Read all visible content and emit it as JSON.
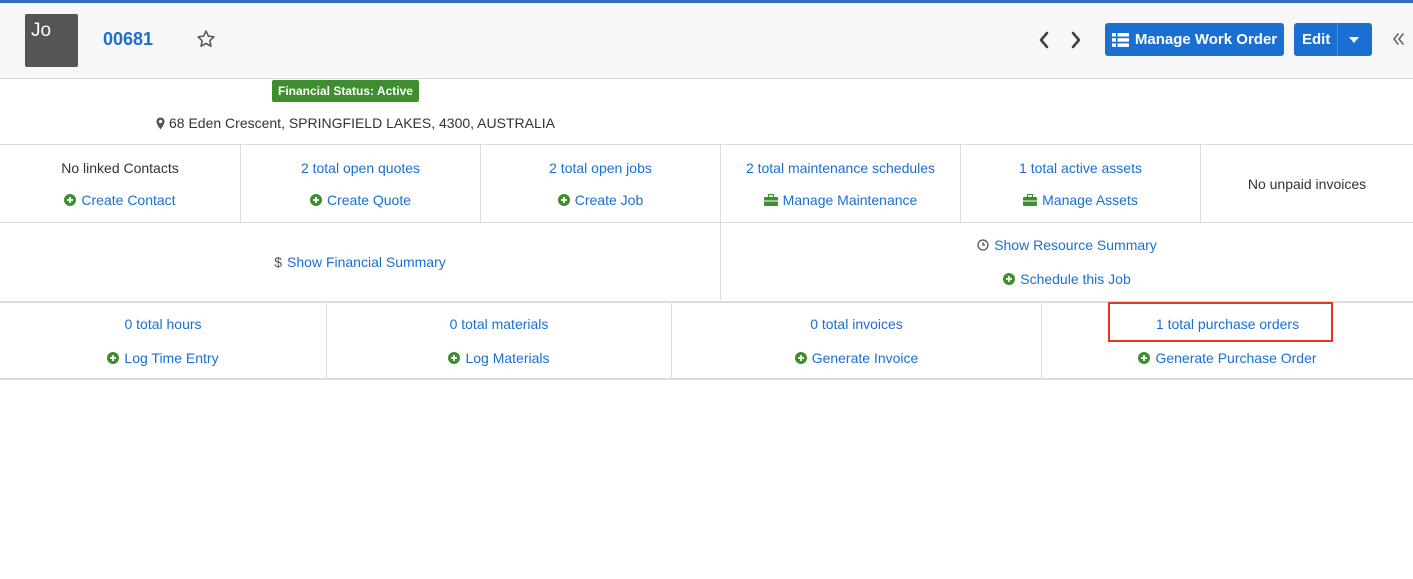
{
  "header": {
    "avatar_initials": "Jo",
    "work_order_number": "00681",
    "manage_button_label": "Manage Work Order",
    "edit_button_label": "Edit"
  },
  "summary": {
    "financial_status": "Financial Status: Active",
    "address": "68 Eden Crescent, SPRINGFIELD LAKES, 4300, AUSTRALIA"
  },
  "overview": {
    "contacts_text": "No linked Contacts",
    "create_contact": "Create Contact",
    "quotes_link": "2 total open quotes",
    "create_quote": "Create Quote",
    "jobs_link": "2 total open jobs",
    "create_job": "Create Job",
    "maintenance_link": "2 total maintenance schedules",
    "manage_maintenance": "Manage Maintenance",
    "assets_link": "1 total active assets",
    "manage_assets": "Manage Assets",
    "invoices_text": "No unpaid invoices"
  },
  "summaries": {
    "financial_summary": "Show Financial Summary",
    "resource_summary": "Show Resource Summary",
    "schedule_job": "Schedule this Job"
  },
  "totals": {
    "hours_link": "0 total hours",
    "log_time": "Log Time Entry",
    "materials_link": "0 total materials",
    "log_materials": "Log Materials",
    "invoices_link": "0 total invoices",
    "generate_invoice": "Generate Invoice",
    "purchase_orders_link": "1 total purchase orders",
    "generate_po": "Generate Purchase Order"
  },
  "colors": {
    "accent": "#1a6fd1",
    "success": "#3e8e2f",
    "highlight": "#e53524"
  }
}
